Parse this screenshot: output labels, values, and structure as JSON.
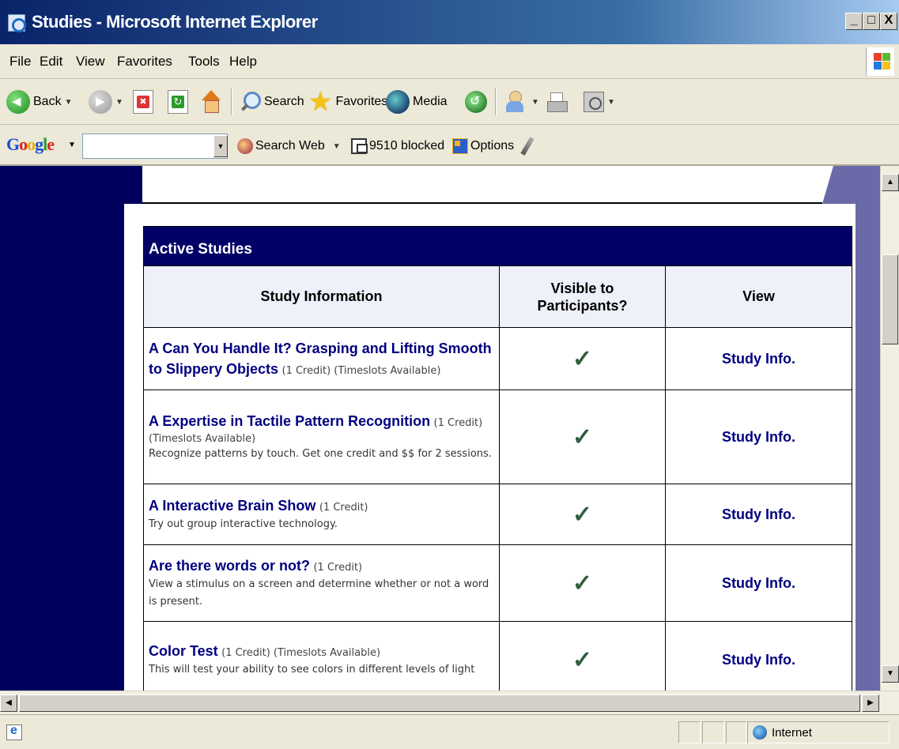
{
  "window": {
    "title": "Studies - Microsoft Internet Explorer",
    "controls": {
      "minimize": "_",
      "maximize": "□",
      "close": "X"
    }
  },
  "menubar": {
    "items": [
      "File",
      "Edit",
      "View",
      "Favorites",
      "Tools",
      "Help"
    ]
  },
  "toolbar": {
    "back_label": "Back",
    "search_label": "Search",
    "favorites_label": "Favorites",
    "media_label": "Media"
  },
  "google_bar": {
    "logo": [
      "G",
      "o",
      "o",
      "g",
      "l",
      "e"
    ],
    "search_value": "",
    "search_web_label": "Search Web",
    "blocked_label": "9510 blocked",
    "options_label": "Options"
  },
  "table": {
    "caption": "Active Studies",
    "headers": {
      "info": "Study Information",
      "visible_line1": "Visible to",
      "visible_line2": "Participants?",
      "view": "View"
    },
    "check_glyph": "✓",
    "rows": [
      {
        "title": "A Can You Handle It? Grasping and Lifting Smooth to Slippery Objects",
        "meta": "(1 Credit) (Timeslots Available)",
        "description": "",
        "link": "Study Info."
      },
      {
        "title": "A Expertise in Tactile Pattern Recognition",
        "meta": "(1 Credit) (Timeslots Available)",
        "description": "Recognize patterns by touch. Get one credit and $$ for 2 sessions.",
        "link": "Study Info."
      },
      {
        "title": "A Interactive Brain Show",
        "meta": "(1 Credit)",
        "description": "Try out group interactive technology.",
        "link": "Study Info."
      },
      {
        "title": "Are there words or not?",
        "meta": "(1 Credit)",
        "description": "View a stimulus on a screen and determine whether or not a word is present.",
        "link": "Study Info."
      },
      {
        "title": "Color Test",
        "meta": "(1 Credit) (Timeslots Available)",
        "description": "This will test your ability to see colors in different levels of light",
        "link": "Study Info."
      }
    ]
  },
  "statusbar": {
    "zone_label": "Internet"
  },
  "colors": {
    "navy": "#000067",
    "link": "#000080",
    "check": "#2e5e3e",
    "side_column": "#00005e",
    "page_background": "#6a6aa8"
  }
}
